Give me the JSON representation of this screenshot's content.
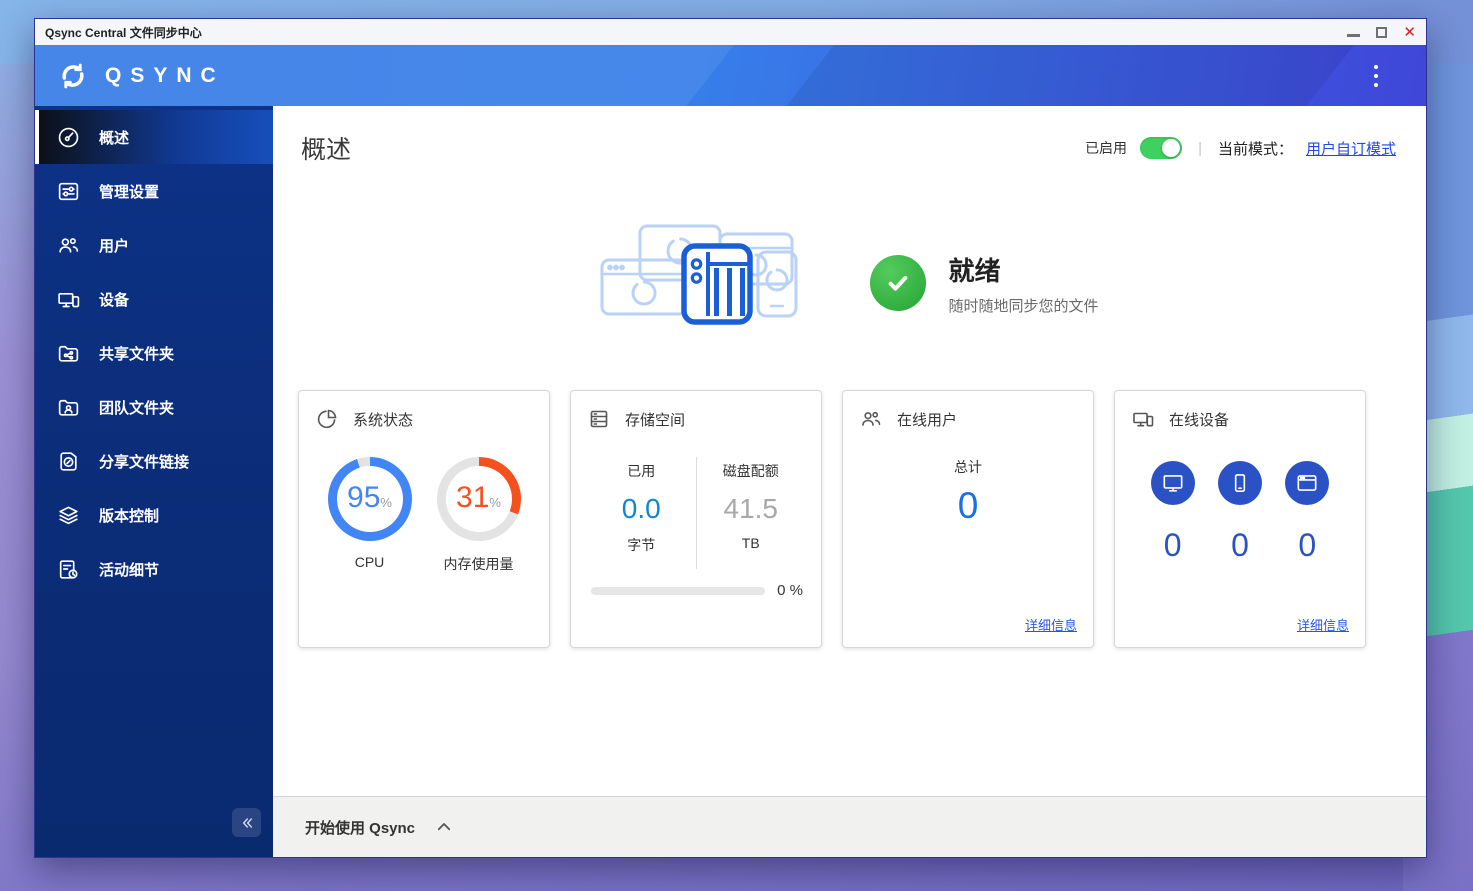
{
  "window": {
    "title": "Qsync Central 文件同步中心"
  },
  "app_header": {
    "logo_text": "QSYNC"
  },
  "sidebar": {
    "items": [
      {
        "label": "概述"
      },
      {
        "label": "管理设置"
      },
      {
        "label": "用户"
      },
      {
        "label": "设备"
      },
      {
        "label": "共享文件夹"
      },
      {
        "label": "团队文件夹"
      },
      {
        "label": "分享文件链接"
      },
      {
        "label": "版本控制"
      },
      {
        "label": "活动细节"
      }
    ]
  },
  "overview": {
    "page_title": "概述",
    "enabled_label": "已启用",
    "enabled": true,
    "mode_label": "当前模式：",
    "mode_value": "用户自订模式",
    "status_title": "就绪",
    "status_subtitle": "随时随地同步您的文件"
  },
  "cards": {
    "system": {
      "title": "系统状态",
      "cpu": {
        "value": 95,
        "unit": "%",
        "label": "CPU",
        "color": "#4285f4"
      },
      "memory": {
        "value": 31,
        "unit": "%",
        "label": "内存使用量",
        "color": "#f4511e"
      }
    },
    "storage": {
      "title": "存储空间",
      "used_label": "已用",
      "used_value": "0.0",
      "used_unit": "字节",
      "quota_label": "磁盘配额",
      "quota_value": "41.5",
      "quota_unit": "TB",
      "percent": 0,
      "percent_label": "0 %"
    },
    "online_users": {
      "title": "在线用户",
      "total_label": "总计",
      "total_value": "0",
      "details_label": "详细信息"
    },
    "online_devices": {
      "title": "在线设备",
      "counts": [
        "0",
        "0",
        "0"
      ],
      "details_label": "详细信息"
    }
  },
  "footer": {
    "getting_started": "开始使用 Qsync"
  },
  "colors": {
    "accent_blue": "#2a52c5",
    "link_blue": "#2356e8",
    "toggle_green": "#3ed160"
  }
}
